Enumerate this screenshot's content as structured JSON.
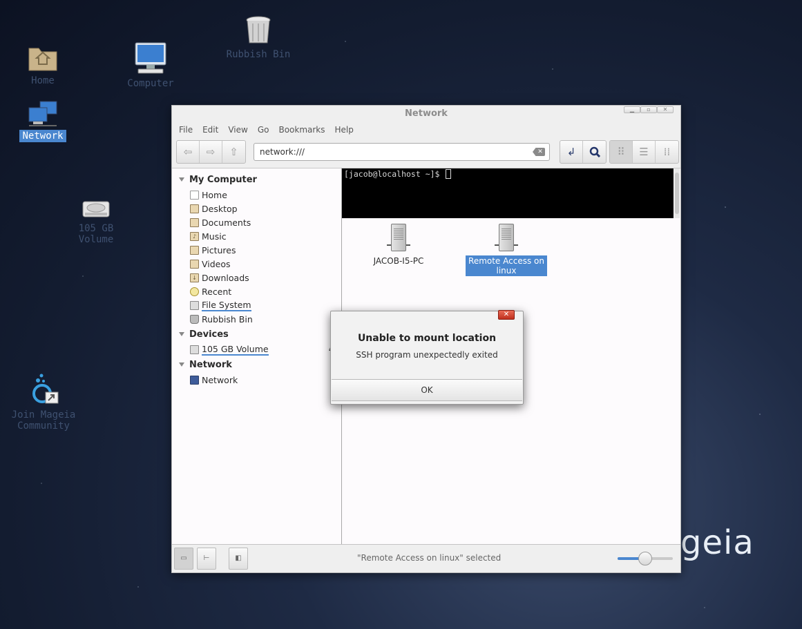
{
  "desktop": {
    "icons": {
      "home": "Home",
      "computer": "Computer",
      "rubbish_bin": "Rubbish Bin",
      "network": "Network",
      "volume": "105 GB Volume",
      "join": "Join Mageia\nCommunity"
    },
    "brand": "geia"
  },
  "window": {
    "title": "Network",
    "menu": [
      "File",
      "Edit",
      "View",
      "Go",
      "Bookmarks",
      "Help"
    ],
    "address": "network:///",
    "sidebar": {
      "sections": {
        "my_computer": "My Computer",
        "devices": "Devices",
        "network": "Network"
      },
      "my_computer_items": [
        "Home",
        "Desktop",
        "Documents",
        "Music",
        "Pictures",
        "Videos",
        "Downloads",
        "Recent",
        "File System",
        "Rubbish Bin"
      ],
      "devices_items": [
        "105 GB Volume"
      ],
      "network_items": [
        "Network"
      ]
    },
    "terminal": {
      "prompt": "[jacob@localhost ~]$ "
    },
    "files": [
      {
        "label": "JACOB-I5-PC"
      },
      {
        "label": "Remote Access on linux"
      }
    ],
    "status": "\"Remote Access on linux\" selected",
    "zoom_level": 0.5
  },
  "dialog": {
    "title": "Unable to mount location",
    "message": "SSH program unexpectedly exited",
    "ok_label": "OK",
    "close_label": "✕"
  }
}
